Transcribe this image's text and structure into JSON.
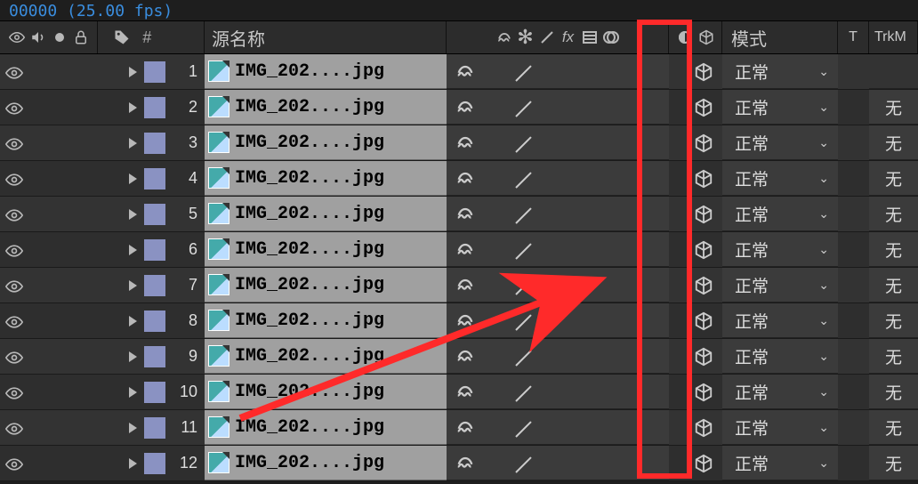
{
  "timecode": "00000 (25.00 fps)",
  "header": {
    "source_name": "源名称",
    "mode": "模式",
    "t": "T",
    "trk": "TrkM"
  },
  "mode_value": "正常",
  "trk_value": "无",
  "layers": [
    {
      "idx": "1",
      "name": "IMG_202....jpg"
    },
    {
      "idx": "2",
      "name": "IMG_202....jpg"
    },
    {
      "idx": "3",
      "name": "IMG_202....jpg"
    },
    {
      "idx": "4",
      "name": "IMG_202....jpg"
    },
    {
      "idx": "5",
      "name": "IMG_202....jpg"
    },
    {
      "idx": "6",
      "name": "IMG_202....jpg"
    },
    {
      "idx": "7",
      "name": "IMG_202....jpg"
    },
    {
      "idx": "8",
      "name": "IMG_202....jpg"
    },
    {
      "idx": "9",
      "name": "IMG_202....jpg"
    },
    {
      "idx": "10",
      "name": "IMG_202....jpg"
    },
    {
      "idx": "11",
      "name": "IMG_202....jpg"
    },
    {
      "idx": "12",
      "name": "IMG_202....jpg"
    }
  ],
  "annotation": {
    "highlight_column": "3d-layer-column",
    "arrow_target": "3d-layer-switch"
  }
}
